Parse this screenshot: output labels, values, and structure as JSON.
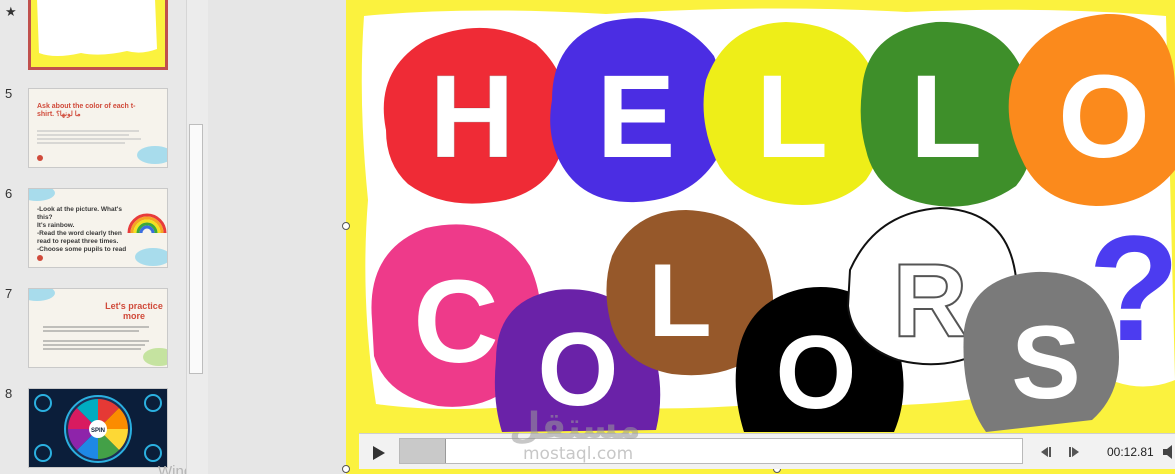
{
  "thumbnails": [
    {
      "number": "",
      "marker": "★",
      "selected": true
    },
    {
      "number": "5",
      "title": "Ask about the color of each t-shirt.",
      "title_ar": "ما لونها؟"
    },
    {
      "number": "6",
      "lines": [
        "-Look at the picture. What's this?",
        "It's rainbow.",
        "-Read the word clearly then",
        "read to repeat three times.",
        "-Choose some pupils to read"
      ]
    },
    {
      "number": "7",
      "title": "Let's practice more"
    },
    {
      "number": "8",
      "center_label": "SPIN"
    }
  ],
  "activate_windows_text": "Windows تنشيط",
  "slide": {
    "word1": [
      "H",
      "E",
      "L",
      "L",
      "O"
    ],
    "word2": [
      "C",
      "O",
      "L",
      "O",
      "R",
      "S"
    ],
    "question_mark": "?",
    "colors": {
      "H": "#ef2b36",
      "E": "#4b2de3",
      "L1": "#eeee18",
      "L2": "#3e8f2a",
      "O1": "#fb8a1c",
      "C": "#ee3a8a",
      "O2": "#6a22a8",
      "L3": "#96582a",
      "O3": "#000000",
      "R": "#ffffff",
      "S": "#7a7a7a",
      "border_yellow": "#fbf23e",
      "question": "#4c3cf0"
    }
  },
  "media": {
    "time": "00:12.81",
    "progress": 0.072
  },
  "watermark": {
    "arabic": "مستقل",
    "english": "mostaql.com"
  }
}
